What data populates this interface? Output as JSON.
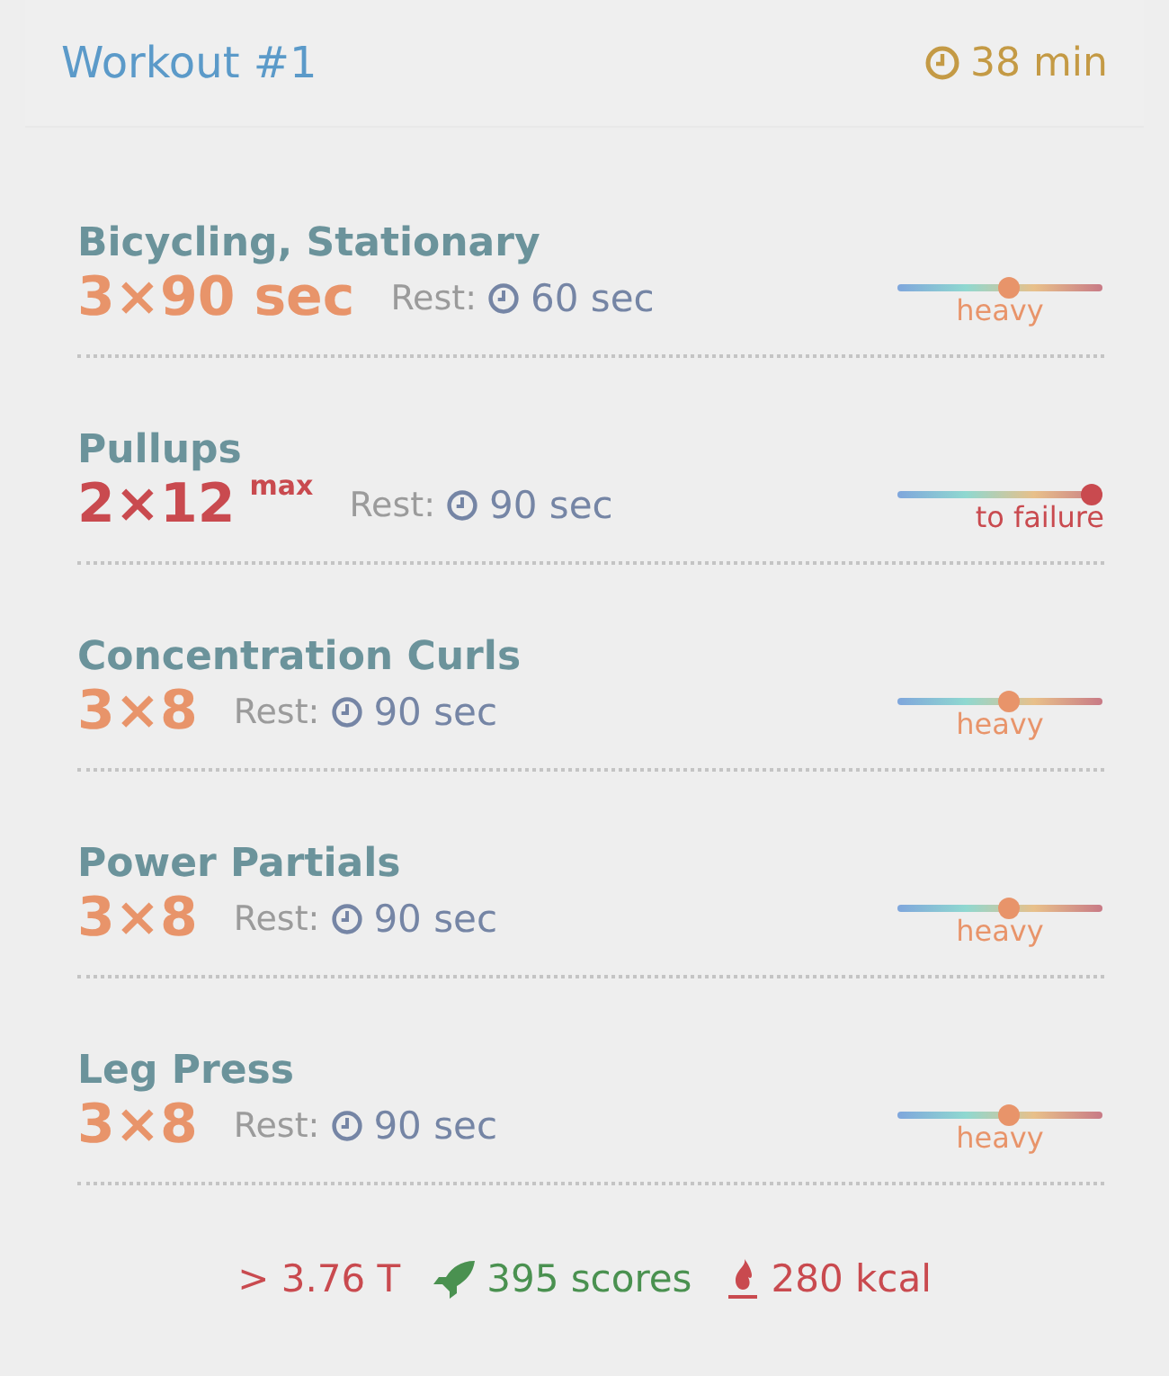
{
  "header": {
    "title": "Workout #1",
    "duration": "38 min"
  },
  "exercises": [
    {
      "name": "Bicycling, Stationary",
      "sets": "3×90 sec",
      "rest_label": "Rest:",
      "rest": "60 sec",
      "kind": "heavy",
      "intensity": "heavy",
      "level": 0.55
    },
    {
      "name": "Pullups",
      "sets": "2×12",
      "note": "max",
      "rest_label": "Rest:",
      "rest": "90 sec",
      "kind": "failure",
      "intensity": "to failure",
      "level": 1
    },
    {
      "name": "Concentration Curls",
      "sets": "3×8",
      "rest_label": "Rest:",
      "rest": "90 sec",
      "kind": "heavy",
      "intensity": "heavy",
      "level": 0.55
    },
    {
      "name": "Power Partials",
      "sets": "3×8",
      "rest_label": "Rest:",
      "rest": "90 sec",
      "kind": "heavy",
      "intensity": "heavy",
      "level": 0.55
    },
    {
      "name": "Leg Press",
      "sets": "3×8",
      "rest_label": "Rest:",
      "rest": "90 sec",
      "kind": "heavy",
      "intensity": "heavy",
      "level": 0.55
    }
  ],
  "summary": {
    "tonnage": "> 3.76 T",
    "scores": "395 scores",
    "calories": "280 kcal"
  }
}
